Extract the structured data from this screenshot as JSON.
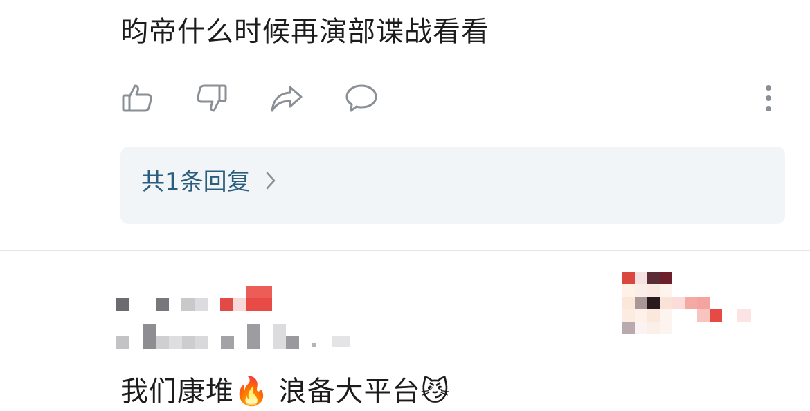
{
  "comment": {
    "text": "昀帝什么时候再演部谍战看看",
    "actions": {
      "like_icon": "thumbs-up-icon",
      "dislike_icon": "thumbs-down-icon",
      "share_icon": "share-arrow-icon",
      "reply_icon": "speech-bubble-icon",
      "more_icon": "vertical-ellipsis-icon"
    },
    "replies_label": "共1条回复",
    "replies_chevron": "chevron-right-icon"
  },
  "next_comment": {
    "text": "我们康堆🔥 浪备大平台😼"
  },
  "colors": {
    "reply_link": "#2a5d7e",
    "reply_box_bg": "#f1f5f7",
    "icon_stroke": "#8a8f96",
    "divider": "#e6e6e6"
  }
}
